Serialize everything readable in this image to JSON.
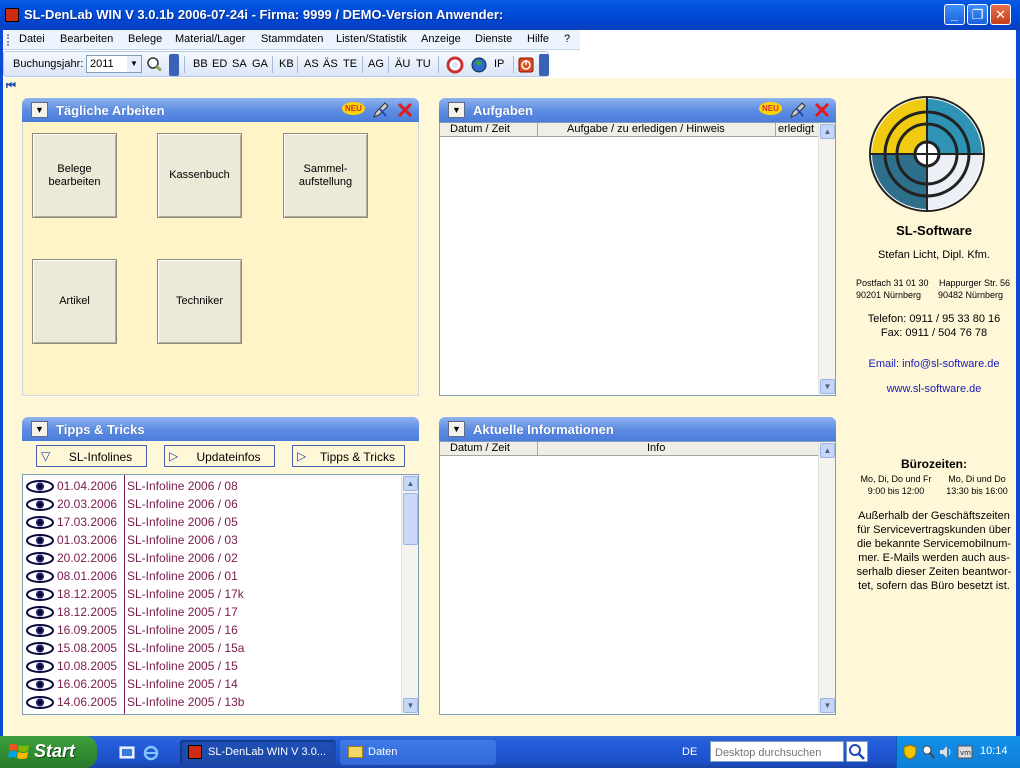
{
  "window": {
    "title": "SL-DenLab WIN V 3.0.1b 2006-07-24i - Firma: 9999 / DEMO-Version Anwender:"
  },
  "menu": [
    "Datei",
    "Bearbeiten",
    "Belege",
    "Material/Lager",
    "Stammdaten",
    "Listen/Statistik",
    "Anzeige",
    "Dienste",
    "Hilfe",
    "?"
  ],
  "toolbar": {
    "year_label": "Buchungsjahr:",
    "year_value": "2011",
    "buttons_a": [
      "BB",
      "ED",
      "SA",
      "GA"
    ],
    "buttons_b": [
      "KB"
    ],
    "buttons_c": [
      "AS",
      "ÄS",
      "TE"
    ],
    "buttons_d": [
      "AG"
    ],
    "buttons_e": [
      "ÄU",
      "TU"
    ],
    "ip_label": "IP"
  },
  "panels": {
    "daily": {
      "title": "Tägliche Arbeiten",
      "new_badge": "NEU",
      "tiles": [
        "Belege\nbearbeiten",
        "Kassenbuch",
        "Sammel-\naufstellung",
        "Artikel",
        "Techniker"
      ]
    },
    "tasks": {
      "title": "Aufgaben",
      "new_badge": "NEU",
      "columns": [
        "Datum / Zeit",
        "Aufgabe / zu erledigen / Hinweis",
        "erledigt"
      ]
    },
    "tips": {
      "title": "Tipps & Tricks",
      "tabs": [
        "SL-Infolines",
        "Updateinfos",
        "Tipps & Tricks"
      ],
      "rows": [
        {
          "date": "01.04.2006",
          "text": "SL-Infoline 2006  /  08"
        },
        {
          "date": "20.03.2006",
          "text": "SL-Infoline 2006  /  06"
        },
        {
          "date": "17.03.2006",
          "text": "SL-Infoline 2006  /  05"
        },
        {
          "date": "01.03.2006",
          "text": "SL-Infoline 2006  /  03"
        },
        {
          "date": "20.02.2006",
          "text": "SL-Infoline 2006  /  02"
        },
        {
          "date": "08.01.2006",
          "text": "SL-Infoline 2006  /  01"
        },
        {
          "date": "18.12.2005",
          "text": "SL-Infoline 2005  /  17k"
        },
        {
          "date": "18.12.2005",
          "text": "SL-Infoline 2005  /  17"
        },
        {
          "date": "16.09.2005",
          "text": "SL-Infoline 2005  /  16"
        },
        {
          "date": "15.08.2005",
          "text": "SL-Infoline 2005  /  15a"
        },
        {
          "date": "10.08.2005",
          "text": "SL-Infoline 2005  /  15"
        },
        {
          "date": "16.06.2005",
          "text": "SL-Infoline 2005  /  14"
        },
        {
          "date": "14.06.2005",
          "text": "SL-Infoline 2005  /  13b"
        }
      ]
    },
    "news": {
      "title": "Aktuelle Informationen",
      "columns": [
        "Datum / Zeit",
        "Info"
      ]
    }
  },
  "company": {
    "name": "SL-Software",
    "owner": "Stefan Licht, Dipl. Kfm.",
    "addr1_left": "Postfach 31 01 30",
    "addr1_right": "Happurger Str. 56",
    "addr2_left": "90201 Nürnberg",
    "addr2_right": "90482 Nürnberg",
    "phone": "Telefon: 0911 / 95 33 80 16",
    "fax": "Fax: 0911 / 504 76 78",
    "email": "Email: info@sl-software.de",
    "web": "www.sl-software.de",
    "hours_title": "Bürozeiten:",
    "hours_left_1": "Mo, Di, Do und Fr",
    "hours_left_2": "9:00 bis 12:00",
    "hours_right_1": "Mo, Di und Do",
    "hours_right_2": "13:30 bis 16:00",
    "note": [
      "Außerhalb der Geschäftszeiten",
      "für Servicevertragskunden über",
      "die bekannte Servicemobilnum-",
      "mer. E-Mails werden auch aus-",
      "serhalb dieser Zeiten beantwor-",
      "tet, sofern das Büro besetzt ist."
    ],
    "colors": {
      "link": "#1a1ab8",
      "accent": "#2a58b8"
    }
  },
  "taskbar": {
    "start": "Start",
    "tasks": [
      "SL-DenLab WIN V 3.0...",
      "Daten"
    ],
    "lang": "DE",
    "search_placeholder": "Desktop durchsuchen",
    "clock": "10:14"
  }
}
